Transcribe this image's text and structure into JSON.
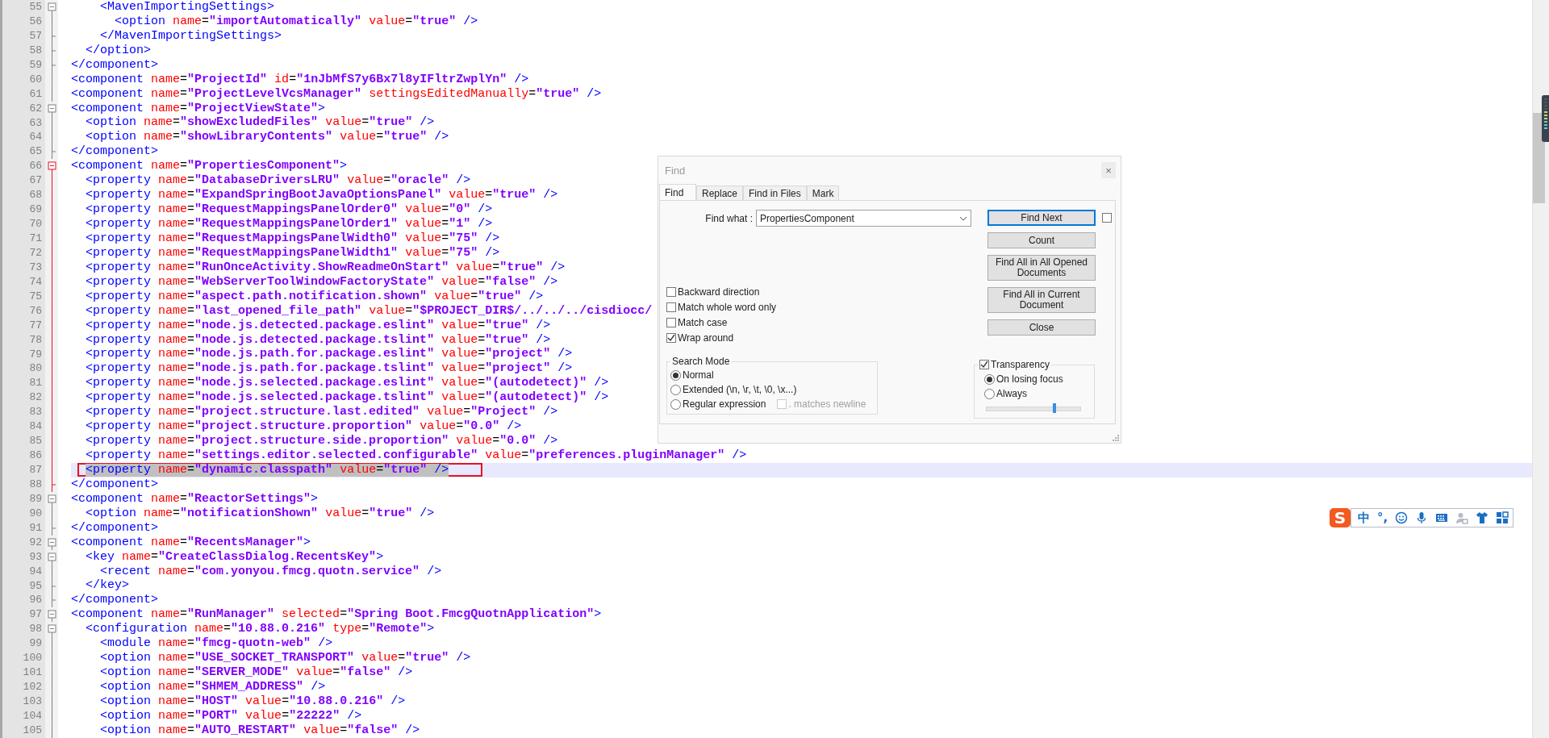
{
  "editor": {
    "lines": [
      {
        "no": "55",
        "text": "    <MavenImportingSettings>",
        "kind": "box",
        "fold_active": false,
        "selected": false,
        "annotated": false
      },
      {
        "no": "56",
        "text": "      <option name=\"importAutomatically\" value=\"true\" />",
        "kind": "line",
        "fold_active": false,
        "selected": false,
        "annotated": false
      },
      {
        "no": "57",
        "text": "    </MavenImportingSettings>",
        "kind": "end",
        "fold_active": false,
        "selected": false,
        "annotated": false
      },
      {
        "no": "58",
        "text": "  </option>",
        "kind": "end",
        "fold_active": false,
        "selected": false,
        "annotated": false
      },
      {
        "no": "59",
        "text": "</component>",
        "kind": "end",
        "fold_active": false,
        "selected": false,
        "annotated": false
      },
      {
        "no": "60",
        "text": "<component name=\"ProjectId\" id=\"1nJbMfS7y6Bx7l8yIFltrZwplYn\" />",
        "kind": "line",
        "fold_active": false,
        "selected": false,
        "annotated": false
      },
      {
        "no": "61",
        "text": "<component name=\"ProjectLevelVcsManager\" settingsEditedManually=\"true\" />",
        "kind": "line",
        "fold_active": false,
        "selected": false,
        "annotated": false
      },
      {
        "no": "62",
        "text": "<component name=\"ProjectViewState\">",
        "kind": "box",
        "fold_active": false,
        "selected": false,
        "annotated": false
      },
      {
        "no": "63",
        "text": "  <option name=\"showExcludedFiles\" value=\"true\" />",
        "kind": "line",
        "fold_active": false,
        "selected": false,
        "annotated": false
      },
      {
        "no": "64",
        "text": "  <option name=\"showLibraryContents\" value=\"true\" />",
        "kind": "line",
        "fold_active": false,
        "selected": false,
        "annotated": false
      },
      {
        "no": "65",
        "text": "</component>",
        "kind": "end",
        "fold_active": false,
        "selected": false,
        "annotated": false
      },
      {
        "no": "66",
        "text": "<component name=\"PropertiesComponent\">",
        "kind": "box",
        "fold_active": true,
        "selected": false,
        "annotated": false
      },
      {
        "no": "67",
        "text": "  <property name=\"DatabaseDriversLRU\" value=\"oracle\" />",
        "kind": "line",
        "fold_active": true,
        "selected": false,
        "annotated": false
      },
      {
        "no": "68",
        "text": "  <property name=\"ExpandSpringBootJavaOptionsPanel\" value=\"true\" />",
        "kind": "line",
        "fold_active": true,
        "selected": false,
        "annotated": false
      },
      {
        "no": "69",
        "text": "  <property name=\"RequestMappingsPanelOrder0\" value=\"0\" />",
        "kind": "line",
        "fold_active": true,
        "selected": false,
        "annotated": false
      },
      {
        "no": "70",
        "text": "  <property name=\"RequestMappingsPanelOrder1\" value=\"1\" />",
        "kind": "line",
        "fold_active": true,
        "selected": false,
        "annotated": false
      },
      {
        "no": "71",
        "text": "  <property name=\"RequestMappingsPanelWidth0\" value=\"75\" />",
        "kind": "line",
        "fold_active": true,
        "selected": false,
        "annotated": false
      },
      {
        "no": "72",
        "text": "  <property name=\"RequestMappingsPanelWidth1\" value=\"75\" />",
        "kind": "line",
        "fold_active": true,
        "selected": false,
        "annotated": false
      },
      {
        "no": "73",
        "text": "  <property name=\"RunOnceActivity.ShowReadmeOnStart\" value=\"true\" />",
        "kind": "line",
        "fold_active": true,
        "selected": false,
        "annotated": false
      },
      {
        "no": "74",
        "text": "  <property name=\"WebServerToolWindowFactoryState\" value=\"false\" />",
        "kind": "line",
        "fold_active": true,
        "selected": false,
        "annotated": false
      },
      {
        "no": "75",
        "text": "  <property name=\"aspect.path.notification.shown\" value=\"true\" />",
        "kind": "line",
        "fold_active": true,
        "selected": false,
        "annotated": false
      },
      {
        "no": "76",
        "text": "  <property name=\"last_opened_file_path\" value=\"$PROJECT_DIR$/../../../cisdiocc/",
        "kind": "line",
        "fold_active": true,
        "selected": false,
        "annotated": false
      },
      {
        "no": "77",
        "text": "  <property name=\"node.js.detected.package.eslint\" value=\"true\" />",
        "kind": "line",
        "fold_active": true,
        "selected": false,
        "annotated": false
      },
      {
        "no": "78",
        "text": "  <property name=\"node.js.detected.package.tslint\" value=\"true\" />",
        "kind": "line",
        "fold_active": true,
        "selected": false,
        "annotated": false
      },
      {
        "no": "79",
        "text": "  <property name=\"node.js.path.for.package.eslint\" value=\"project\" />",
        "kind": "line",
        "fold_active": true,
        "selected": false,
        "annotated": false
      },
      {
        "no": "80",
        "text": "  <property name=\"node.js.path.for.package.tslint\" value=\"project\" />",
        "kind": "line",
        "fold_active": true,
        "selected": false,
        "annotated": false
      },
      {
        "no": "81",
        "text": "  <property name=\"node.js.selected.package.eslint\" value=\"(autodetect)\" />",
        "kind": "line",
        "fold_active": true,
        "selected": false,
        "annotated": false
      },
      {
        "no": "82",
        "text": "  <property name=\"node.js.selected.package.tslint\" value=\"(autodetect)\" />",
        "kind": "line",
        "fold_active": true,
        "selected": false,
        "annotated": false
      },
      {
        "no": "83",
        "text": "  <property name=\"project.structure.last.edited\" value=\"Project\" />",
        "kind": "line",
        "fold_active": true,
        "selected": false,
        "annotated": false
      },
      {
        "no": "84",
        "text": "  <property name=\"project.structure.proportion\" value=\"0.0\" />",
        "kind": "line",
        "fold_active": true,
        "selected": false,
        "annotated": false
      },
      {
        "no": "85",
        "text": "  <property name=\"project.structure.side.proportion\" value=\"0.0\" />",
        "kind": "line",
        "fold_active": true,
        "selected": false,
        "annotated": false
      },
      {
        "no": "86",
        "text": "  <property name=\"settings.editor.selected.configurable\" value=\"preferences.pluginManager\" />",
        "kind": "line",
        "fold_active": true,
        "selected": false,
        "annotated": false
      },
      {
        "no": "87",
        "text": "  <property name=\"dynamic.classpath\" value=\"true\" />",
        "kind": "line",
        "fold_active": true,
        "selected": true,
        "annotated": true
      },
      {
        "no": "88",
        "text": "</component>",
        "kind": "end",
        "fold_active": true,
        "selected": false,
        "annotated": false
      },
      {
        "no": "89",
        "text": "<component name=\"ReactorSettings\">",
        "kind": "box",
        "fold_active": false,
        "selected": false,
        "annotated": false
      },
      {
        "no": "90",
        "text": "  <option name=\"notificationShown\" value=\"true\" />",
        "kind": "line",
        "fold_active": false,
        "selected": false,
        "annotated": false
      },
      {
        "no": "91",
        "text": "</component>",
        "kind": "end",
        "fold_active": false,
        "selected": false,
        "annotated": false
      },
      {
        "no": "92",
        "text": "<component name=\"RecentsManager\">",
        "kind": "box",
        "fold_active": false,
        "selected": false,
        "annotated": false
      },
      {
        "no": "93",
        "text": "  <key name=\"CreateClassDialog.RecentsKey\">",
        "kind": "box",
        "fold_active": false,
        "selected": false,
        "annotated": false
      },
      {
        "no": "94",
        "text": "    <recent name=\"com.yonyou.fmcg.quotn.service\" />",
        "kind": "line",
        "fold_active": false,
        "selected": false,
        "annotated": false
      },
      {
        "no": "95",
        "text": "  </key>",
        "kind": "end",
        "fold_active": false,
        "selected": false,
        "annotated": false
      },
      {
        "no": "96",
        "text": "</component>",
        "kind": "end",
        "fold_active": false,
        "selected": false,
        "annotated": false
      },
      {
        "no": "97",
        "text": "<component name=\"RunManager\" selected=\"Spring Boot.FmcgQuotnApplication\">",
        "kind": "box",
        "fold_active": false,
        "selected": false,
        "annotated": false
      },
      {
        "no": "98",
        "text": "  <configuration name=\"10.88.0.216\" type=\"Remote\">",
        "kind": "box",
        "fold_active": false,
        "selected": false,
        "annotated": false
      },
      {
        "no": "99",
        "text": "    <module name=\"fmcg-quotn-web\" />",
        "kind": "line",
        "fold_active": false,
        "selected": false,
        "annotated": false
      },
      {
        "no": "100",
        "text": "    <option name=\"USE_SOCKET_TRANSPORT\" value=\"true\" />",
        "kind": "line",
        "fold_active": false,
        "selected": false,
        "annotated": false
      },
      {
        "no": "101",
        "text": "    <option name=\"SERVER_MODE\" value=\"false\" />",
        "kind": "line",
        "fold_active": false,
        "selected": false,
        "annotated": false
      },
      {
        "no": "102",
        "text": "    <option name=\"SHMEM_ADDRESS\" />",
        "kind": "line",
        "fold_active": false,
        "selected": false,
        "annotated": false
      },
      {
        "no": "103",
        "text": "    <option name=\"HOST\" value=\"10.88.0.216\" />",
        "kind": "line",
        "fold_active": false,
        "selected": false,
        "annotated": false
      },
      {
        "no": "104",
        "text": "    <option name=\"PORT\" value=\"22222\" />",
        "kind": "line",
        "fold_active": false,
        "selected": false,
        "annotated": false
      },
      {
        "no": "105",
        "text": "    <option name=\"AUTO_RESTART\" value=\"false\" />",
        "kind": "line",
        "fold_active": false,
        "selected": false,
        "annotated": false
      }
    ]
  },
  "find_dialog": {
    "title": "Find",
    "close": "×",
    "tabs": [
      {
        "label": "Find",
        "selected": true
      },
      {
        "label": "Replace",
        "selected": false
      },
      {
        "label": "Find in Files",
        "selected": false
      },
      {
        "label": "Mark",
        "selected": false
      }
    ],
    "find_what": {
      "label": "Find what :",
      "value": "PropertiesComponent"
    },
    "buttons": [
      {
        "label": "Find Next",
        "default": true
      },
      {
        "label": "Count",
        "default": false
      },
      {
        "label": "Find All in All Opened Documents",
        "default": false
      },
      {
        "label": "Find All in Current Document",
        "default": false
      },
      {
        "label": "Close",
        "default": false
      }
    ],
    "pin_checked": false,
    "options": [
      {
        "label": "Backward direction",
        "checked": false
      },
      {
        "label": "Match whole word only",
        "checked": false
      },
      {
        "label": "Match case",
        "checked": false
      },
      {
        "label": "Wrap around",
        "checked": true
      }
    ],
    "search_mode": {
      "title": "Search Mode",
      "modes": [
        {
          "label": "Normal",
          "selected": true
        },
        {
          "label": "Extended (\\n, \\r, \\t, \\0, \\x...)",
          "selected": false
        },
        {
          "label": "Regular expression",
          "selected": false
        }
      ],
      "matches_newline": {
        "label": ". matches newline",
        "checked": false,
        "disabled": true
      }
    },
    "transparency": {
      "label": "Transparency",
      "checked": true,
      "modes": [
        {
          "label": "On losing focus",
          "selected": true
        },
        {
          "label": "Always",
          "selected": false
        }
      ],
      "level": 0.72
    }
  },
  "ime_toolbar": {
    "logo": "S",
    "language": "中",
    "punctuation": "°,"
  }
}
